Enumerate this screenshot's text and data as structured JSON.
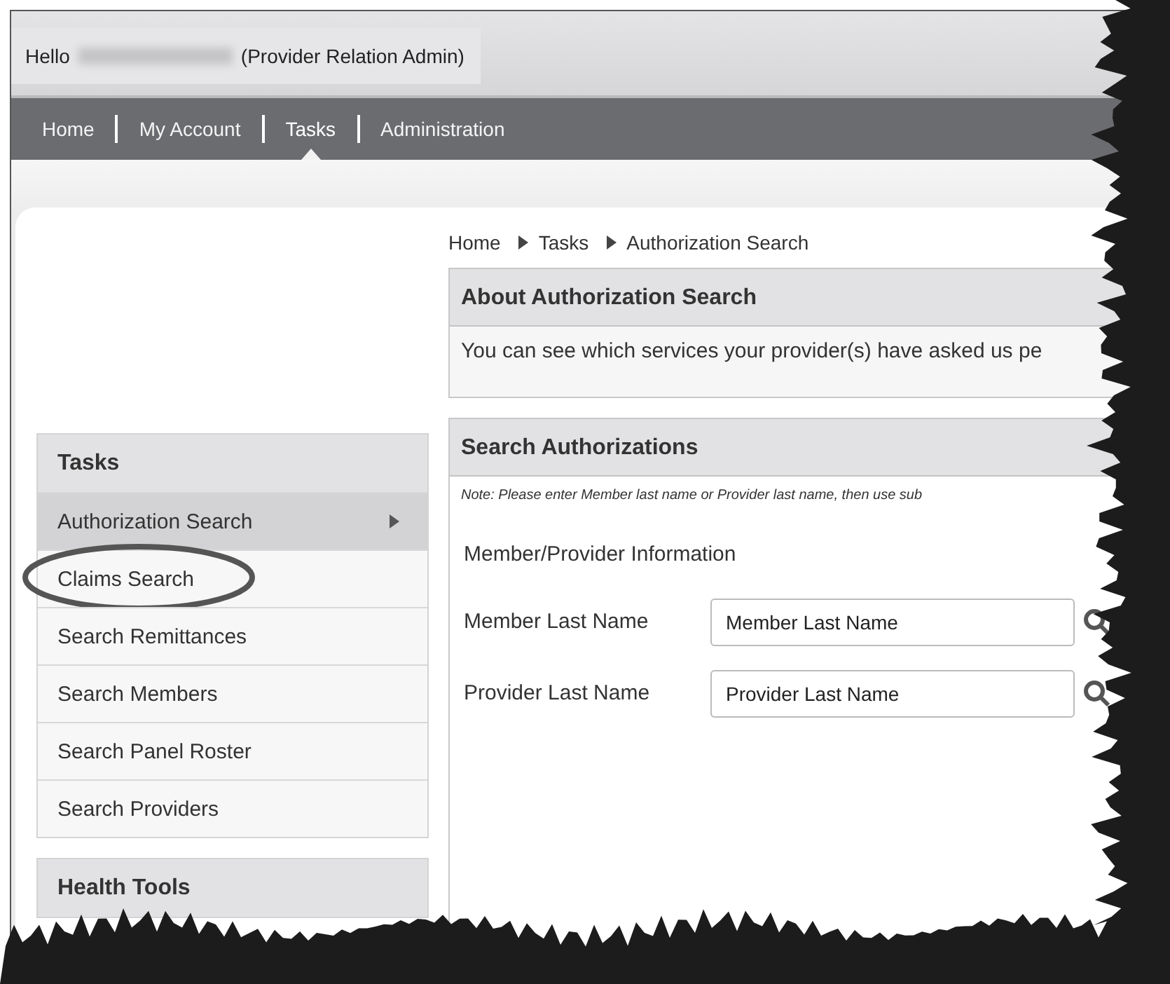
{
  "header": {
    "greeting": "Hello",
    "role": "(Provider Relation Admin)"
  },
  "nav": [
    {
      "label": "Home",
      "selected": false
    },
    {
      "label": "My Account",
      "selected": false
    },
    {
      "label": "Tasks",
      "selected": true
    },
    {
      "label": "Administration",
      "selected": false
    }
  ],
  "breadcrumb": [
    "Home",
    "Tasks",
    "Authorization Search"
  ],
  "about": {
    "title": "About Authorization Search",
    "text": "You can see which services your provider(s) have asked us pe"
  },
  "search": {
    "title": "Search Authorizations",
    "note": "Note: Please enter Member last name or Provider last name, then use sub",
    "section": "Member/Provider Information",
    "fields": [
      {
        "label": "Member Last Name",
        "placeholder": "Member Last Name"
      },
      {
        "label": "Provider Last Name",
        "placeholder": "Provider Last Name"
      }
    ]
  },
  "sidebar": {
    "title": "Tasks",
    "items": [
      {
        "label": "Authorization Search",
        "selected": true,
        "circled": false
      },
      {
        "label": "Claims Search",
        "selected": false,
        "circled": true
      },
      {
        "label": "Search Remittances",
        "selected": false,
        "circled": false
      },
      {
        "label": "Search Members",
        "selected": false,
        "circled": false
      },
      {
        "label": "Search Panel Roster",
        "selected": false,
        "circled": false
      },
      {
        "label": "Search Providers",
        "selected": false,
        "circled": false
      }
    ],
    "next_title": "Health Tools"
  }
}
